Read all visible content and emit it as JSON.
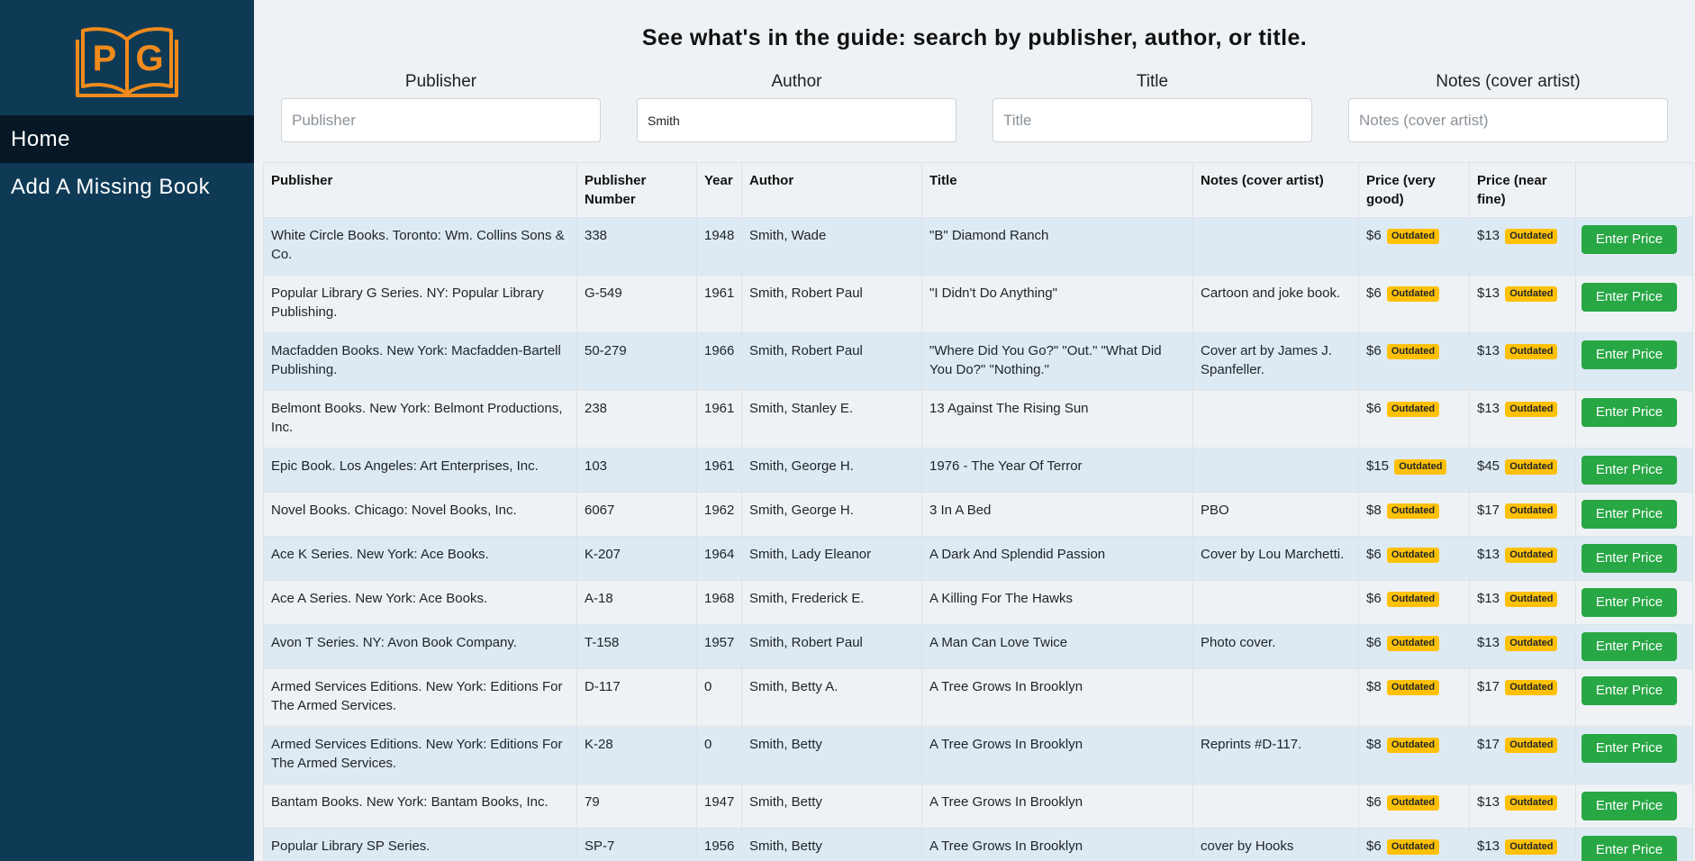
{
  "brand": {
    "logo_text": "PG",
    "accent": "#f08a1c",
    "sidebar_bg": "#0e3a56"
  },
  "nav": {
    "home": "Home",
    "add_missing_book": "Add A Missing Book"
  },
  "heading": "See what's in the guide: search by publisher, author, or title.",
  "filters": {
    "publisher": {
      "label": "Publisher",
      "placeholder": "Publisher",
      "value": ""
    },
    "author": {
      "label": "Author",
      "placeholder": "Author",
      "value": "Smith"
    },
    "title": {
      "label": "Title",
      "placeholder": "Title",
      "value": ""
    },
    "notes": {
      "label": "Notes (cover artist)",
      "placeholder": "Notes (cover artist)",
      "value": ""
    }
  },
  "table": {
    "headers": [
      "Publisher",
      "Publisher Number",
      "Year",
      "Author",
      "Title",
      "Notes (cover artist)",
      "Price (very good)",
      "Price (near fine)",
      ""
    ],
    "badge_label": "Outdated",
    "button_label": "Enter Price",
    "rows": [
      {
        "publisher": "White Circle Books. Toronto: Wm. Collins Sons & Co.",
        "number": "338",
        "year": "1948",
        "author": "Smith, Wade",
        "title": "\"B\" Diamond Ranch",
        "notes": "",
        "price_vg": "$6",
        "price_nf": "$13"
      },
      {
        "publisher": "Popular Library G Series. NY: Popular Library Publishing.",
        "number": "G-549",
        "year": "1961",
        "author": "Smith, Robert Paul",
        "title": "\"I Didn't Do Anything\"",
        "notes": "Cartoon and joke book.",
        "price_vg": "$6",
        "price_nf": "$13"
      },
      {
        "publisher": "Macfadden Books. New York: Macfadden-Bartell Publishing.",
        "number": "50-279",
        "year": "1966",
        "author": "Smith, Robert Paul",
        "title": "\"Where Did You Go?\" \"Out.\" \"What Did You Do?\" \"Nothing.\"",
        "notes": "Cover art by James J. Spanfeller.",
        "price_vg": "$6",
        "price_nf": "$13"
      },
      {
        "publisher": "Belmont Books. New York: Belmont Productions, Inc.",
        "number": "238",
        "year": "1961",
        "author": "Smith, Stanley E.",
        "title": "13 Against The Rising Sun",
        "notes": "",
        "price_vg": "$6",
        "price_nf": "$13"
      },
      {
        "publisher": "Epic Book. Los Angeles: Art Enterprises, Inc.",
        "number": "103",
        "year": "1961",
        "author": "Smith, George H.",
        "title": "1976 - The Year Of Terror",
        "notes": "",
        "price_vg": "$15",
        "price_nf": "$45"
      },
      {
        "publisher": "Novel Books. Chicago: Novel Books, Inc.",
        "number": "6067",
        "year": "1962",
        "author": "Smith, George H.",
        "title": "3 In A Bed",
        "notes": "PBO",
        "price_vg": "$8",
        "price_nf": "$17"
      },
      {
        "publisher": "Ace K Series. New York: Ace Books.",
        "number": "K-207",
        "year": "1964",
        "author": "Smith, Lady Eleanor",
        "title": "A Dark And Splendid Passion",
        "notes": "Cover by Lou Marchetti.",
        "price_vg": "$6",
        "price_nf": "$13"
      },
      {
        "publisher": "Ace A Series. New York: Ace Books.",
        "number": "A-18",
        "year": "1968",
        "author": "Smith, Frederick E.",
        "title": "A Killing For The Hawks",
        "notes": "",
        "price_vg": "$6",
        "price_nf": "$13"
      },
      {
        "publisher": "Avon T Series. NY: Avon Book Company.",
        "number": "T-158",
        "year": "1957",
        "author": "Smith, Robert Paul",
        "title": "A Man Can Love Twice",
        "notes": "Photo cover.",
        "price_vg": "$6",
        "price_nf": "$13"
      },
      {
        "publisher": "Armed Services Editions. New York: Editions For The Armed Services.",
        "number": "D-117",
        "year": "0",
        "author": "Smith, Betty A.",
        "title": "A Tree Grows In Brooklyn",
        "notes": "",
        "price_vg": "$8",
        "price_nf": "$17"
      },
      {
        "publisher": "Armed Services Editions. New York: Editions For The Armed Services.",
        "number": "K-28",
        "year": "0",
        "author": "Smith, Betty",
        "title": "A Tree Grows In Brooklyn",
        "notes": "Reprints #D-117.",
        "price_vg": "$8",
        "price_nf": "$17"
      },
      {
        "publisher": "Bantam Books. New York: Bantam Books, Inc.",
        "number": "79",
        "year": "1947",
        "author": "Smith, Betty",
        "title": "A Tree Grows In Brooklyn",
        "notes": "",
        "price_vg": "$6",
        "price_nf": "$13"
      },
      {
        "publisher": "Popular Library SP Series.",
        "number": "SP-7",
        "year": "1956",
        "author": "Smith, Betty",
        "title": "A Tree Grows In Brooklyn",
        "notes": "cover by Hooks",
        "price_vg": "$6",
        "price_nf": "$13"
      }
    ]
  }
}
